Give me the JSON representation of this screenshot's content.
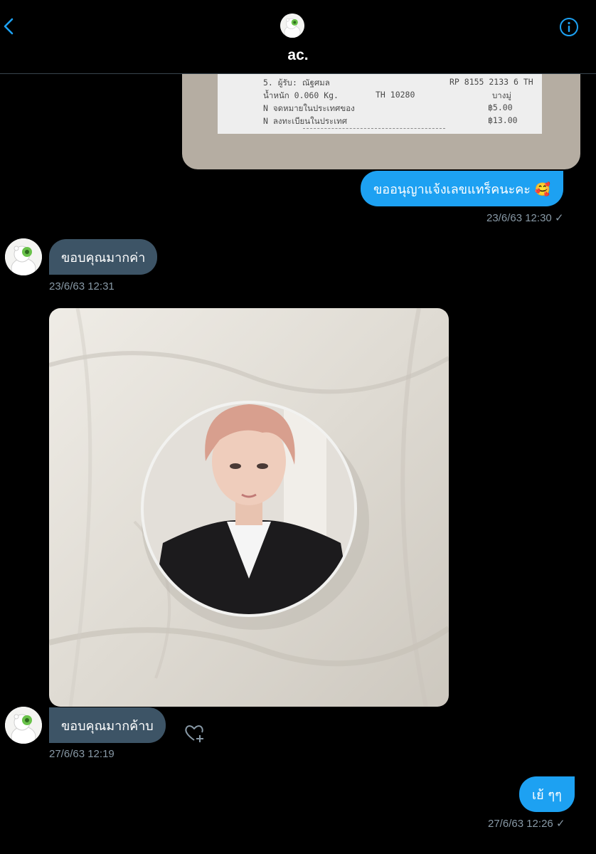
{
  "header": {
    "title": "ac.",
    "accent": "#1da1f2"
  },
  "receipt": {
    "lines": [
      {
        "left": "5. ผู้รับ: ณัฐศมล",
        "right": "RP 8155 2133 6 TH"
      },
      {
        "left": "น้ำหนัก 0.060 Kg.",
        "mid": "TH 10280",
        "right": "บางมู่"
      },
      {
        "left": "N จดหมายในประเทศของ",
        "right": "฿5.00"
      },
      {
        "left": "N ลงทะเบียนในประเทศ",
        "right": "฿13.00"
      }
    ]
  },
  "messages": [
    {
      "direction": "outgoing",
      "text": "ขออนุญาแจ้งเลขแทร็คนะคะ 🥰",
      "time": "23/6/63 12:30",
      "read_mark": "✓"
    },
    {
      "direction": "incoming",
      "text": "ขอบคุณมากค่า",
      "time": "23/6/63 12:31"
    },
    {
      "direction": "incoming",
      "type": "photo",
      "photo_icon": "photo-badge-image"
    },
    {
      "direction": "incoming",
      "text": "ขอบคุณมากค้าบ",
      "time": "27/6/63 12:19",
      "reaction_icon": "heart-plus-icon"
    },
    {
      "direction": "outgoing",
      "text": "เย้ ๆๆ",
      "time": "27/6/63 12:26",
      "read_mark": "✓"
    }
  ],
  "colors": {
    "outgoing_bubble": "#1da1f2",
    "incoming_bubble": "#3d5466",
    "timestamp": "#8899a6",
    "divider": "#38444d"
  }
}
